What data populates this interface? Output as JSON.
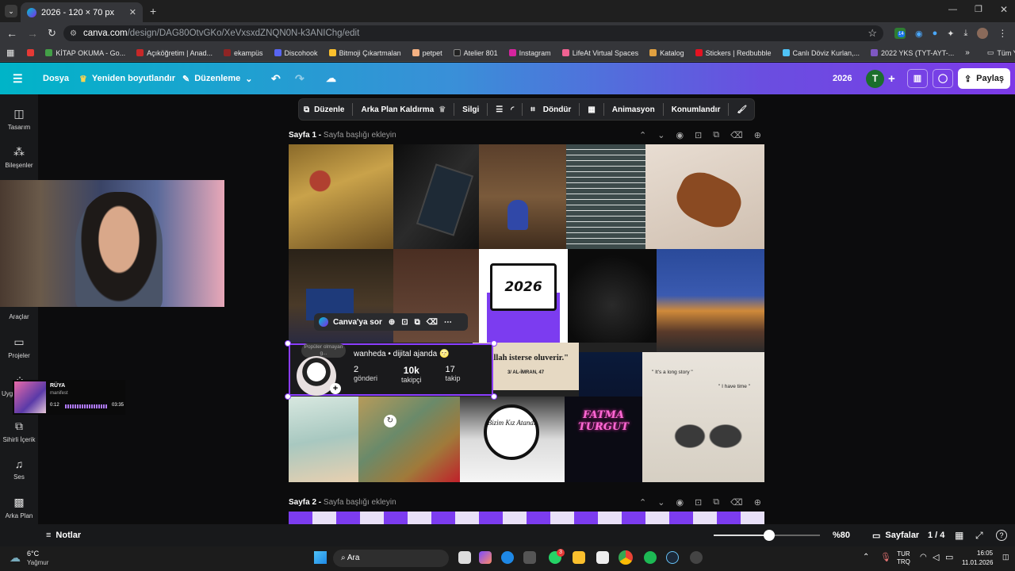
{
  "browser": {
    "tab_title": "2026 - 120 × 70 px",
    "url_domain": "canva.com",
    "url_path": "/design/DAG80OtvGKo/XeVxsxdZNQN0N-k3ANIChg/edit",
    "bookmarks": [
      "KİTAP OKUMA - Go...",
      "Açıköğretim | Anad...",
      "ekampüs",
      "Discohook",
      "Bitmoji Çıkartmalan",
      "petpet",
      "Atelier 801",
      "Instagram",
      "LifeAt Virtual Spaces",
      "Katalog",
      "Stickers | Redbubble",
      "Canlı Döviz Kurlan,...",
      "2022 YKS (TYT-AYT-..."
    ],
    "all_bookmarks": "Tüm Yer İşaretleri",
    "ext_badge": "14"
  },
  "header": {
    "file": "Dosya",
    "resize": "Yeniden boyutlandır",
    "edit": "Düzenleme",
    "doc_title": "2026",
    "avatar_letter": "T",
    "share": "Paylaş"
  },
  "sidebar": {
    "items": [
      "Tasarım",
      "Bileşenler",
      "Araçlar",
      "Projeler",
      "Uygu",
      "Sihirli İçerik",
      "Ses",
      "Arka Plan"
    ]
  },
  "toolbar": {
    "edit": "Düzenle",
    "remove_bg": "Arka Plan Kaldırma",
    "erase": "Silgi",
    "flip": "Döndür",
    "animate": "Animasyon",
    "position": "Konumlandır"
  },
  "pages": {
    "page1_label": "Sayfa 1 -",
    "page1_hint": "Sayfa başlığı ekleyin",
    "page2_label": "Sayfa 2 -",
    "page2_hint": "Sayfa başlığı ekleyin"
  },
  "design": {
    "year": "2026",
    "profile_name": "wanheda • dijital ajanda 🌝",
    "profile_bubble": "Popüler olmayan g...",
    "stats": [
      {
        "value": "2",
        "label": "gönderi"
      },
      {
        "value": "10k",
        "label": "takipçi"
      },
      {
        "value": "17",
        "label": "takip"
      }
    ],
    "quote": "\"Allah isterse oluverir.\"",
    "quote_ref": "3/ AL-İMRAN, 47",
    "story1": "\" It's a long story \"",
    "story2": "\" I have time \"",
    "cake_text": "Bizim Kız Atandı",
    "neon": "FATMA TURGUT"
  },
  "floating": {
    "ask": "Canva'ya sor"
  },
  "bottom": {
    "notes": "Notlar",
    "zoom": "%80",
    "zoom_fraction": 0.52,
    "pages": "Sayfalar",
    "page_count": "1 / 4"
  },
  "spotify": {
    "title": "RÜYA",
    "artist": "manifest",
    "elapsed": "0:12",
    "total": "03:35"
  },
  "taskbar": {
    "weather_temp": "6°C",
    "weather_desc": "Yağmur",
    "search": "Ara",
    "lang": "TUR",
    "lang2": "TRQ",
    "time": "16:05",
    "date": "11.01.2026",
    "whatsapp_badge": "3"
  },
  "colors": {
    "accent_purple": "#7d2ae8",
    "accent_teal": "#00c4cc",
    "selection": "#8b3dff"
  }
}
